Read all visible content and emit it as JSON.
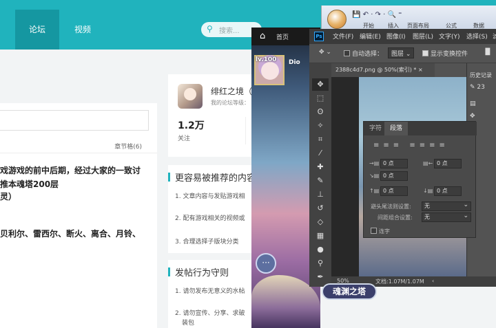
{
  "forum": {
    "nav": {
      "forum": "论坛",
      "video": "视频"
    },
    "search_placeholder": "搜索...",
    "post": {
      "chapter_index": "章节格(6)",
      "lines": [
        "戏游戏的前中后期，经过大家的一致讨",
        "推本魂塔200层",
        "灵）",
        "贝利尔、雷西尔、断火、离合、月铃、"
      ]
    },
    "user": {
      "name": "绯红之境（",
      "level_label": "我的论坛等级：",
      "followers": "1.2万",
      "follow_label": "关注"
    },
    "recommend": {
      "title": "更容易被推荐的内容",
      "items": [
        "1. 文章内容与发贴游戏相",
        "2. 配有游戏相关的视频或",
        "3. 合理选择子版块分类"
      ]
    },
    "rules": {
      "title": "发帖行为守则",
      "items": [
        "1. 请勿发布无意义的水帖",
        "2. 请勿宣传、分享、求破",
        "装包"
      ]
    }
  },
  "game": {
    "home": "首页",
    "level": "lv.100",
    "player": "Dio",
    "banner": "魂渊之塔",
    "chat_icon": "chat-icon"
  },
  "office": {
    "quick_access": "💾 ↶ · ↷ · 🔍 ⁼",
    "ribbon_tabs": [
      "开始",
      "插入",
      "页面布局",
      "公式",
      "数据"
    ]
  },
  "photoshop": {
    "logo": "Ps",
    "menu": [
      "文件(F)",
      "编辑(E)",
      "图像(I)",
      "图层(L)",
      "文字(Y)",
      "选择(S)",
      "滤"
    ],
    "options": {
      "auto_select": "自动选择：",
      "layer": "图层",
      "show_transform": "显示变换控件"
    },
    "doc_tab": "2388c4d7.png @ 50%(索引) *  ×",
    "status": {
      "zoom": "50%",
      "doc": "文档:1.07M/1.07M"
    },
    "history": {
      "title": "历史记录",
      "item": "23"
    },
    "panel": {
      "tabs": [
        "字符",
        "段落"
      ],
      "fields": {
        "left_indent": "0 点",
        "right_indent": "0 点",
        "first_indent": "0 点",
        "space_before": "0 点",
        "space_after": "0 点"
      },
      "kinsoku_label": "避头尾法则设置:",
      "kinsoku_value": "无",
      "mojikumi_label": "间距组合设置:",
      "mojikumi_value": "无",
      "hyphenate": "连字"
    }
  }
}
